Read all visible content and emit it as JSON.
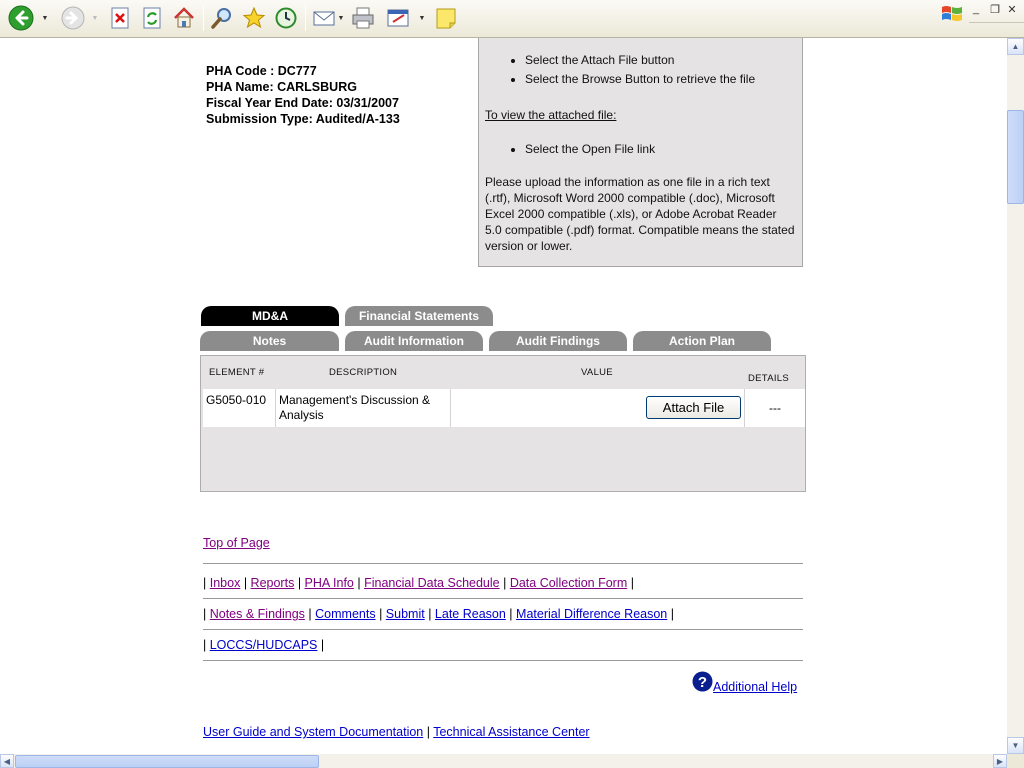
{
  "browser": {
    "toolbar_icons": [
      "back-icon",
      "forward-icon",
      "stop-icon",
      "refresh-icon",
      "home-icon",
      "search-icon",
      "favorites-icon",
      "history-icon",
      "mail-icon",
      "print-icon",
      "edit-icon",
      "sticky-note-icon"
    ]
  },
  "pha": {
    "code": "PHA Code : DC777",
    "name": "PHA Name: CARLSBURG",
    "fiscal_year_end": "Fiscal Year End Date: 03/31/2007",
    "submission_type": "Submission Type: Audited/A-133"
  },
  "instructions": {
    "attach_steps": [
      "Select the Attach File button",
      "Select the Browse Button to retrieve the file"
    ],
    "view_heading": "To view the attached file:",
    "view_steps": [
      "Select the Open File link"
    ],
    "note": "Please upload the information as one file in a rich text (.rtf), Microsoft Word 2000 compatible (.doc), Microsoft Excel 2000 compatible (.xls), or Adobe Acrobat Reader 5.0 compatible (.pdf) format. Compatible means the stated version or lower."
  },
  "tabs": {
    "mda": "MD&A",
    "financial_statements": "Financial Statements",
    "notes": "Notes",
    "audit_information": "Audit Information",
    "audit_findings": "Audit Findings",
    "action_plan": "Action Plan"
  },
  "table": {
    "headers": {
      "element": "ELEMENT #",
      "description": "DESCRIPTION",
      "value": "VALUE",
      "details": "DETAILS"
    },
    "row": {
      "element": "G5050-010",
      "description": "Management's Discussion & Analysis",
      "button": "Attach File",
      "details": "---"
    }
  },
  "links": {
    "top_of_page": "Top of Page",
    "inbox": "Inbox",
    "reports": "Reports",
    "pha_info": "PHA Info",
    "financial_data_schedule": "Financial Data Schedule",
    "data_collection_form": "Data Collection Form",
    "notes_findings": "Notes & Findings",
    "comments": "Comments",
    "submit": "Submit",
    "late_reason": "Late Reason",
    "material_difference_reason": "Material Difference Reason",
    "loccs_hudcaps": "LOCCS/HUDCAPS",
    "additional_help": "Additional Help",
    "user_guide": "User Guide and System Documentation",
    "technical_assistance": "Technical Assistance Center"
  },
  "separators": {
    "pipe": "|"
  }
}
